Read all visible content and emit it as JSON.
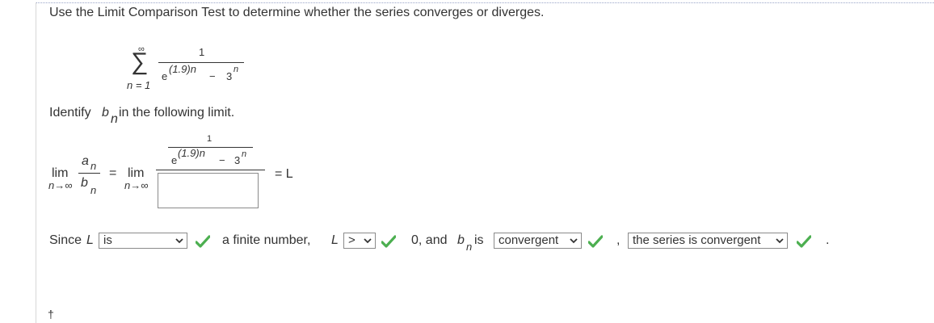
{
  "question": {
    "instruction": "Use the Limit Comparison Test to determine whether the series converges or diverges."
  },
  "series": {
    "sigma": "∑",
    "upper": "∞",
    "lower": "n = 1",
    "numerator": "1",
    "denominator": {
      "base": "e",
      "exponent": "(1.9)n",
      "minus": "−",
      "term_base": "3",
      "term_exponent": "n"
    }
  },
  "identify": {
    "prefix": "Identify ",
    "var_b": "b",
    "var_sub": "n",
    "suffix": " in the following limit."
  },
  "limit": {
    "lim": "lim",
    "under": "n→∞",
    "frac_top_a": "a",
    "frac_top_sub": "n",
    "frac_bot_b": "b",
    "frac_bot_sub": "n",
    "equals": "=",
    "lim2": "lim",
    "under2": "n→∞",
    "inner_numerator": "1",
    "inner_denominator": {
      "base": "e",
      "exponent": "(1.9)n",
      "minus": "−",
      "term_base": "3",
      "term_exponent": "n"
    },
    "answer_value": "",
    "equals_L": "= L"
  },
  "conclusion": {
    "since_prefix": "Since ",
    "since_L": "L",
    "dropdown1_value": "is",
    "text_finite": "a finite number, ",
    "text_L": "L",
    "dropdown2_value": ">",
    "text_zero_and": "0, and ",
    "text_b": "b",
    "text_b_sub": "n",
    "text_is": " is",
    "dropdown3_value": "convergent",
    "comma": ",",
    "dropdown4_value": "the series is convergent",
    "period": "."
  },
  "footer": {
    "dagger": "†"
  },
  "colors": {
    "check_green": "#4caf50",
    "text": "#333333"
  },
  "icons": {
    "check": "check-icon",
    "chevron": "chevron-down-icon"
  }
}
